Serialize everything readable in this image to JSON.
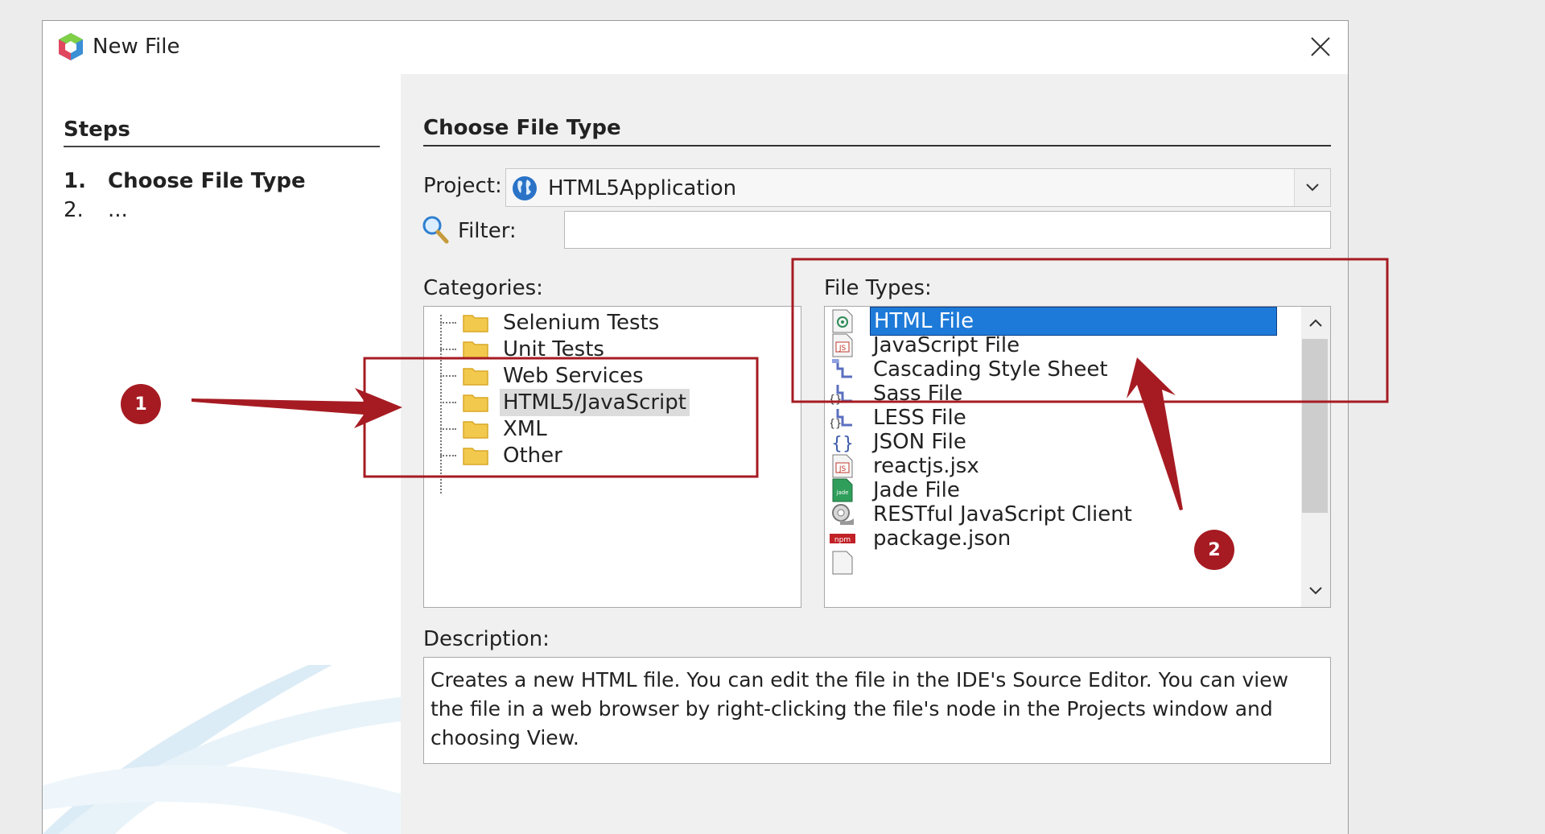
{
  "window": {
    "title": "New File"
  },
  "steps": {
    "heading": "Steps",
    "items": [
      {
        "number": "1.",
        "label": "Choose File Type"
      },
      {
        "number": "2.",
        "label": "..."
      }
    ]
  },
  "main": {
    "heading": "Choose File Type",
    "project": {
      "label": "Project:",
      "value": "HTML5Application"
    },
    "filter": {
      "label": "Filter:",
      "value": ""
    },
    "categories": {
      "label": "Categories:",
      "items": [
        "Selenium Tests",
        "Unit Tests",
        "Web Services",
        "HTML5/JavaScript",
        "XML",
        "Other"
      ],
      "selected": "HTML5/JavaScript"
    },
    "file_types": {
      "label": "File Types:",
      "items": [
        {
          "label": "HTML File",
          "icon": "html-file-icon"
        },
        {
          "label": "JavaScript File",
          "icon": "javascript-file-icon"
        },
        {
          "label": "Cascading Style Sheet",
          "icon": "css-file-icon"
        },
        {
          "label": "Sass File",
          "icon": "sass-file-icon"
        },
        {
          "label": "LESS File",
          "icon": "less-file-icon"
        },
        {
          "label": "JSON File",
          "icon": "json-file-icon"
        },
        {
          "label": "reactjs.jsx",
          "icon": "jsx-file-icon"
        },
        {
          "label": "Jade File",
          "icon": "jade-file-icon"
        },
        {
          "label": "RESTful JavaScript Client",
          "icon": "restful-client-icon"
        },
        {
          "label": "package.json",
          "icon": "npm-icon"
        }
      ],
      "selected": "HTML File"
    },
    "description": {
      "label": "Description:",
      "text": "Creates a new HTML file. You can edit the file in the IDE's Source Editor. You can view the file in a web browser by right-clicking the file's node in the Projects window and choosing View."
    }
  },
  "annotations": {
    "badge_1": "1",
    "badge_2": "2"
  },
  "colors": {
    "selection": "#1e7ad8",
    "annotation": "#a61b22"
  }
}
